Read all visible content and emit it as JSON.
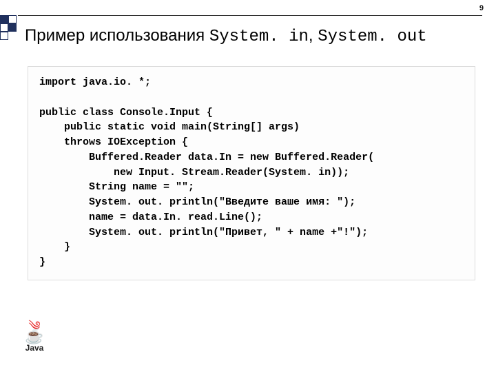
{
  "page_number": "9",
  "title_prefix": "Пример использования ",
  "title_code1": "System. in",
  "title_sep": ", ",
  "title_code2": "System. out",
  "code": {
    "l1": "import java.io. *;",
    "l2": "",
    "l3": "public class Console.Input {",
    "l4": "    public static void main(String[] args)",
    "l5": "    throws IOException {",
    "l6": "        Buffered.Reader data.In = new Buffered.Reader(",
    "l7": "            new Input. Stream.Reader(System. in));",
    "l8": "        String name = \"\";",
    "l9": "        System. out. println(\"Введите ваше имя: \");",
    "l10": "        name = data.In. read.Line();",
    "l11": "        System. out. println(\"Привет, \" + name +\"!\");",
    "l12": "    }",
    "l13": "}"
  },
  "logo_text": "Java"
}
